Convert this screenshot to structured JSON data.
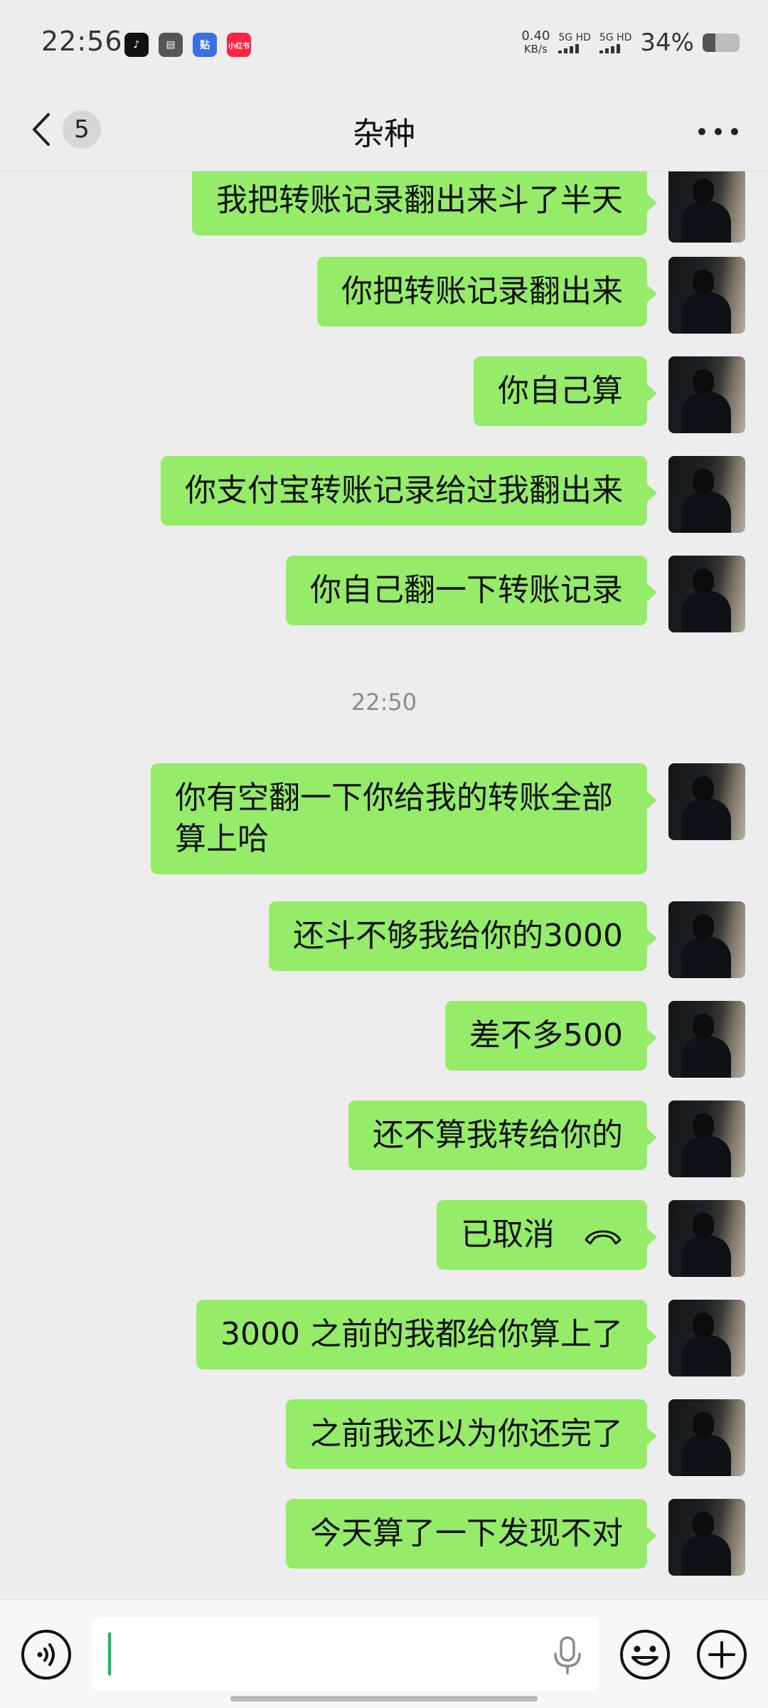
{
  "status_bar": {
    "time": "22:56",
    "speed_value": "0.40",
    "speed_unit": "KB/s",
    "sim1": "5G HD",
    "sim2": "5G HD",
    "battery_percent": "34%",
    "battery_level": 0.34,
    "app_icons": [
      "tiktok-icon",
      "wallet-icon",
      "tieba-icon",
      "xiaohongshu-icon"
    ],
    "app_badge_text": [
      "",
      "",
      "贴",
      "小红书"
    ]
  },
  "header": {
    "unread_count": "5",
    "title": "杂种"
  },
  "chat": {
    "messages": [
      {
        "text": "我把转账记录翻出来斗了半天"
      },
      {
        "text": "你把转账记录翻出来"
      },
      {
        "text": "你自己算"
      },
      {
        "text": "你支付宝转账记录给过我翻出来"
      },
      {
        "text": "你自己翻一下转账记录"
      }
    ],
    "time_divider": "22:50",
    "messages_after": [
      {
        "text": "你有空翻一下你给我的转账全部算上哈"
      },
      {
        "text": "还斗不够我给你的3000"
      },
      {
        "text": "差不多500"
      },
      {
        "text": "还不算我转给你的"
      },
      {
        "text": "已取消"
      },
      {
        "text": "3000 之前的我都给你算上了"
      },
      {
        "text": "之前我还以为你还完了"
      },
      {
        "text": "今天算了一下发现不对"
      }
    ]
  },
  "colors": {
    "bubble_self": "#95ec69",
    "background": "#ededed",
    "cursor": "#07c160"
  }
}
